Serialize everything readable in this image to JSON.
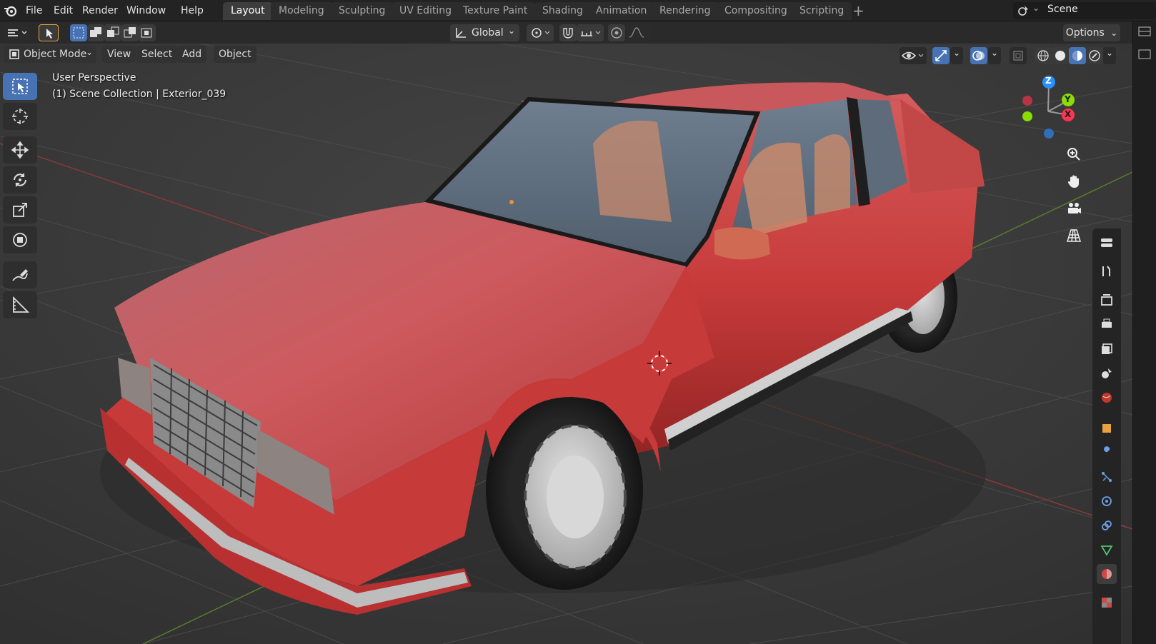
{
  "menubar": {
    "items": [
      "File",
      "Edit",
      "Render",
      "Window",
      "Help"
    ],
    "workspaces": [
      "Layout",
      "Modeling",
      "Sculpting",
      "UV Editing",
      "Texture Paint",
      "Shading",
      "Animation",
      "Rendering",
      "Compositing",
      "Scripting"
    ],
    "active_workspace": "Layout",
    "scene_name": "Scene"
  },
  "tool_header": {
    "orientation": "Global",
    "options_label": "Options"
  },
  "viewport_header": {
    "mode": "Object Mode",
    "menus": [
      "View",
      "Select",
      "Add",
      "Object"
    ]
  },
  "viewport": {
    "perspective_label": "User Perspective",
    "collection_label": "(1) Scene Collection | Exterior_039",
    "gizmo_axes": [
      "Z",
      "Y",
      "X"
    ]
  },
  "colors": {
    "accent": "#4772b3",
    "car_body": "#c83b3b",
    "axis_x": "#ff3352",
    "axis_y": "#8bdc00",
    "axis_z": "#2890ff"
  }
}
